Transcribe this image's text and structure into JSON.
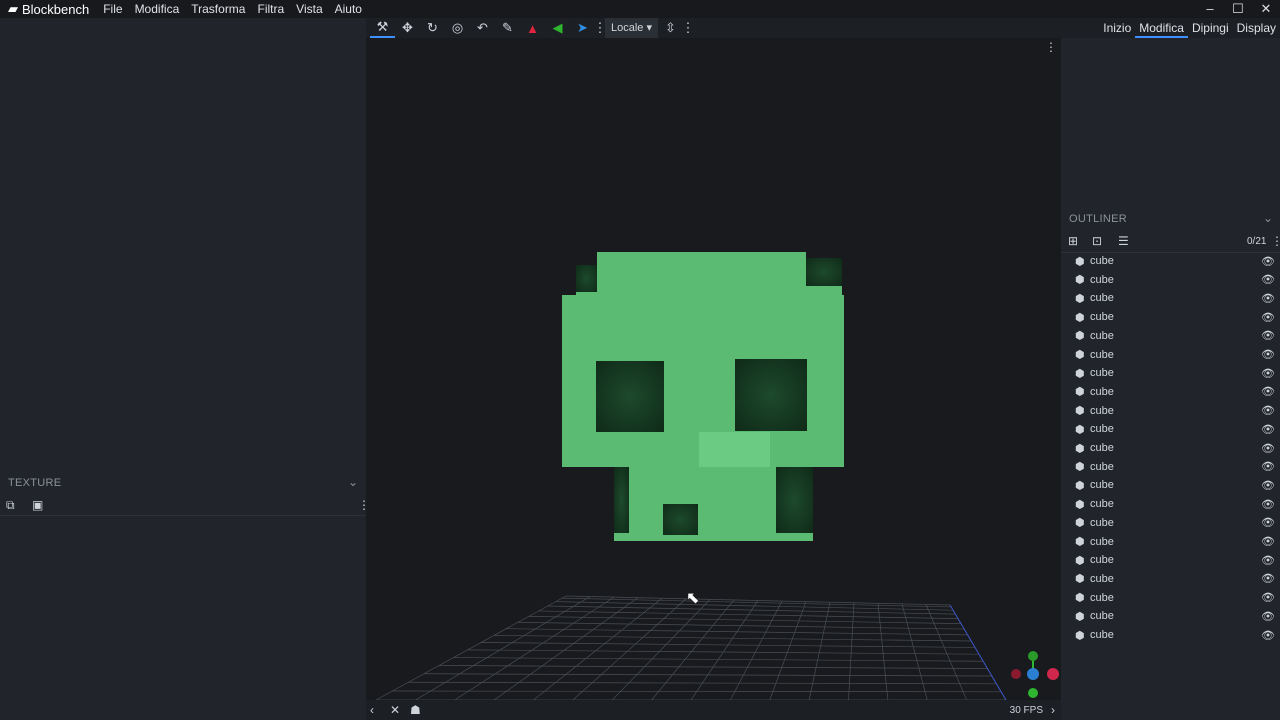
{
  "app": {
    "title": "Blockbench",
    "menu": [
      "File",
      "Modifica",
      "Trasforma",
      "Filtra",
      "Vista",
      "Aiuto"
    ]
  },
  "toolbar": {
    "space_select": "Locale"
  },
  "modes": [
    "Inizio",
    "Modifica",
    "Dipingi",
    "Display"
  ],
  "texture_panel": {
    "title": "TEXTURE"
  },
  "outliner": {
    "title": "OUTLINER",
    "count": "0/21",
    "items": [
      "cube",
      "cube",
      "cube",
      "cube",
      "cube",
      "cube",
      "cube",
      "cube",
      "cube",
      "cube",
      "cube",
      "cube",
      "cube",
      "cube",
      "cube",
      "cube",
      "cube",
      "cube",
      "cube",
      "cube",
      "cube"
    ]
  },
  "viewport": {
    "fps": "30 FPS"
  },
  "colors": {
    "accent": "#3e90ff",
    "model": "#5cbb73"
  }
}
